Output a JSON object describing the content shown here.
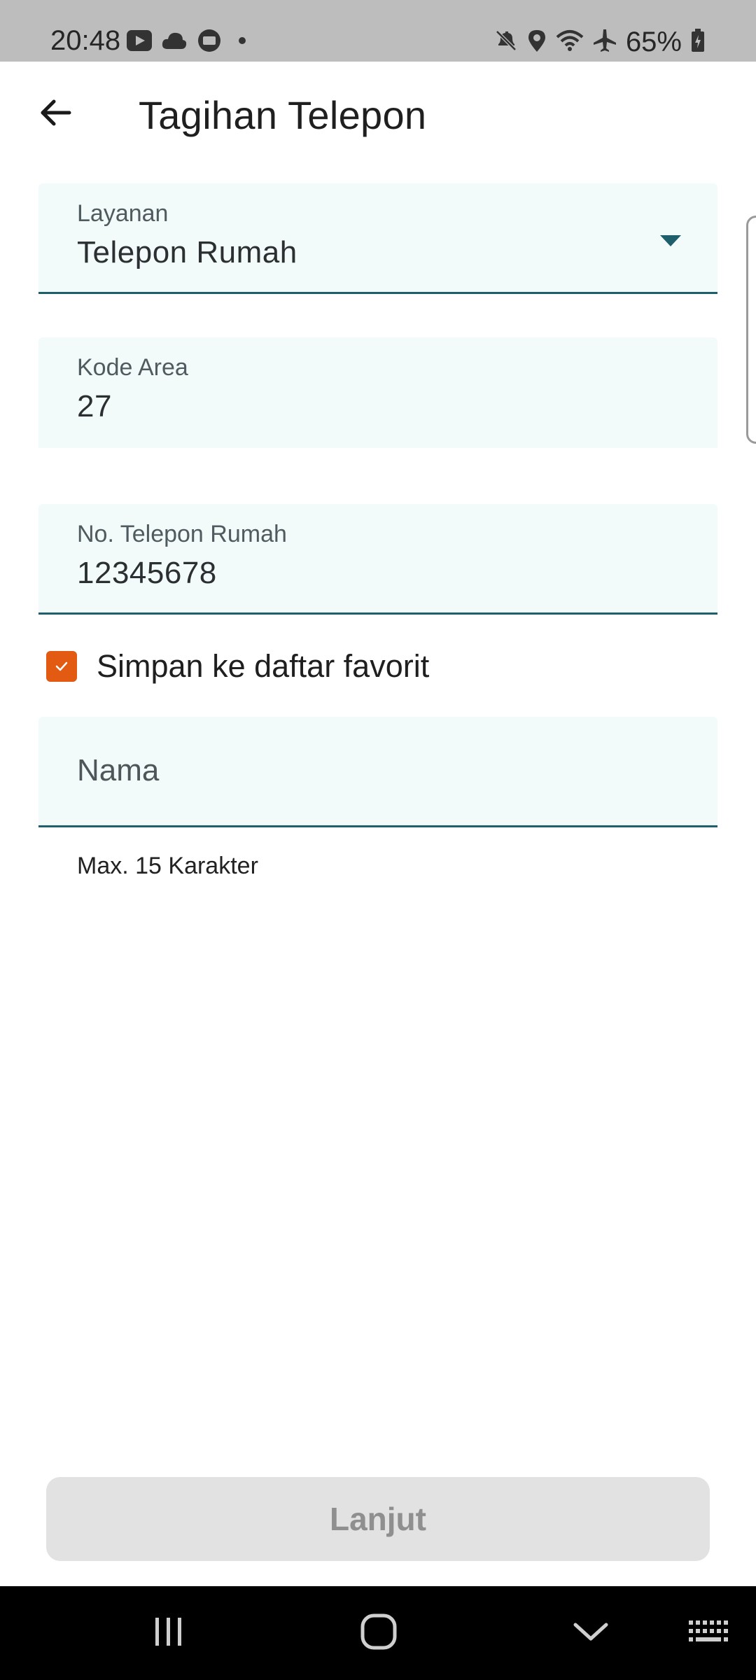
{
  "status_bar": {
    "time": "20:48",
    "battery": "65%",
    "left_icons": [
      "youtube-icon",
      "cloud-icon",
      "chat-icon",
      "dot-icon"
    ],
    "right_icons": [
      "mute-icon",
      "location-icon",
      "wifi-icon",
      "airplane-icon",
      "battery-icon"
    ]
  },
  "app_bar": {
    "title": "Tagihan Telepon",
    "back_icon": "arrow-left-icon"
  },
  "form": {
    "layanan": {
      "label": "Layanan",
      "value": "Telepon Rumah"
    },
    "kode_area": {
      "label": "Kode Area",
      "value": "27"
    },
    "no_telepon": {
      "label": "No. Telepon Rumah",
      "value": "12345678"
    },
    "favorite_checkbox": {
      "label": "Simpan ke daftar favorit",
      "checked": true
    },
    "nama": {
      "placeholder": "Nama",
      "helper": "Max. 15 Karakter"
    }
  },
  "primary_button": {
    "label": "Lanjut",
    "enabled": false
  },
  "colors": {
    "accent": "#1f5f6b",
    "checkbox": "#e35a12",
    "field_bg": "#f3fbfa",
    "button_disabled_bg": "#e2e2e2"
  },
  "nav_bar": {
    "icons": [
      "recents-icon",
      "home-icon",
      "hide-keyboard-icon",
      "keyboard-icon"
    ]
  }
}
